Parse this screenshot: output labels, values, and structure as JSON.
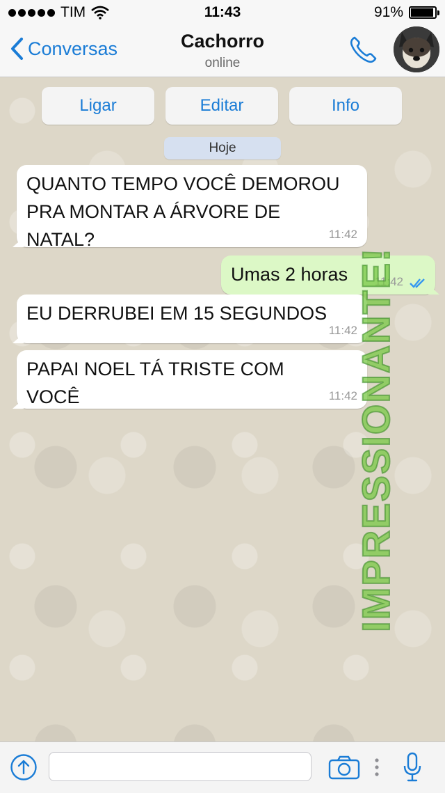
{
  "status_bar": {
    "carrier": "TIM",
    "time": "11:43",
    "battery": "91%"
  },
  "nav": {
    "back_label": "Conversas",
    "contact_name": "Cachorro",
    "contact_status": "online"
  },
  "actions": {
    "call_label": "Ligar",
    "edit_label": "Editar",
    "info_label": "Info"
  },
  "date_label": "Hoje",
  "messages": [
    {
      "direction": "incoming",
      "text": "QUANTO TEMPO VOCÊ DEMOROU\nPRA MONTAR A ÁRVORE DE\nNATAL?",
      "time": "11:42"
    },
    {
      "direction": "outgoing",
      "text": "Umas 2 horas",
      "time": "11:42",
      "read": true
    },
    {
      "direction": "incoming",
      "text": "EU DERRUBEI EM 15 SEGUNDOS",
      "time": "11:42"
    },
    {
      "direction": "incoming",
      "text": "PAPAI NOEL TÁ TRISTE COM\nVOCÊ",
      "time": "11:42"
    }
  ],
  "watermark": "IMPRESSIONANTE!",
  "input": {
    "value": "",
    "placeholder": ""
  },
  "colors": {
    "accent": "#1a7cd6",
    "outgoing_bubble": "#dcf8c6",
    "incoming_bubble": "#ffffff",
    "read_check": "#3497f0"
  }
}
